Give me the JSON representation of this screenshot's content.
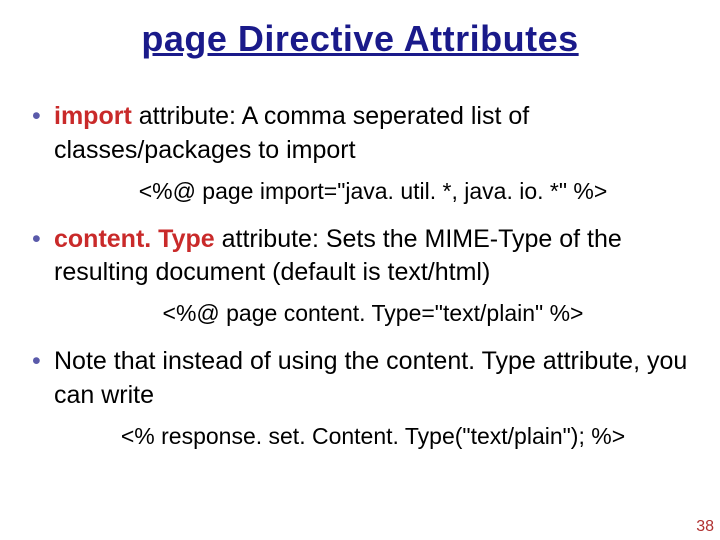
{
  "title": "page Directive Attributes",
  "bullets": [
    {
      "attr": "import",
      "rest": " attribute: A comma seperated list of classes/packages to import",
      "code": "<%@ page import=\"java. util. *, java. io. *\" %>"
    },
    {
      "attr": "content. Type",
      "rest": " attribute: Sets the MIME-Type of the resulting document (default is text/html)",
      "code": "<%@ page content. Type=\"text/plain\" %>"
    },
    {
      "attr": "",
      "rest": "Note that instead of using the content. Type attribute, you can write",
      "code": "<% response. set. Content. Type(\"text/plain\"); %>"
    }
  ],
  "page_number": "38"
}
